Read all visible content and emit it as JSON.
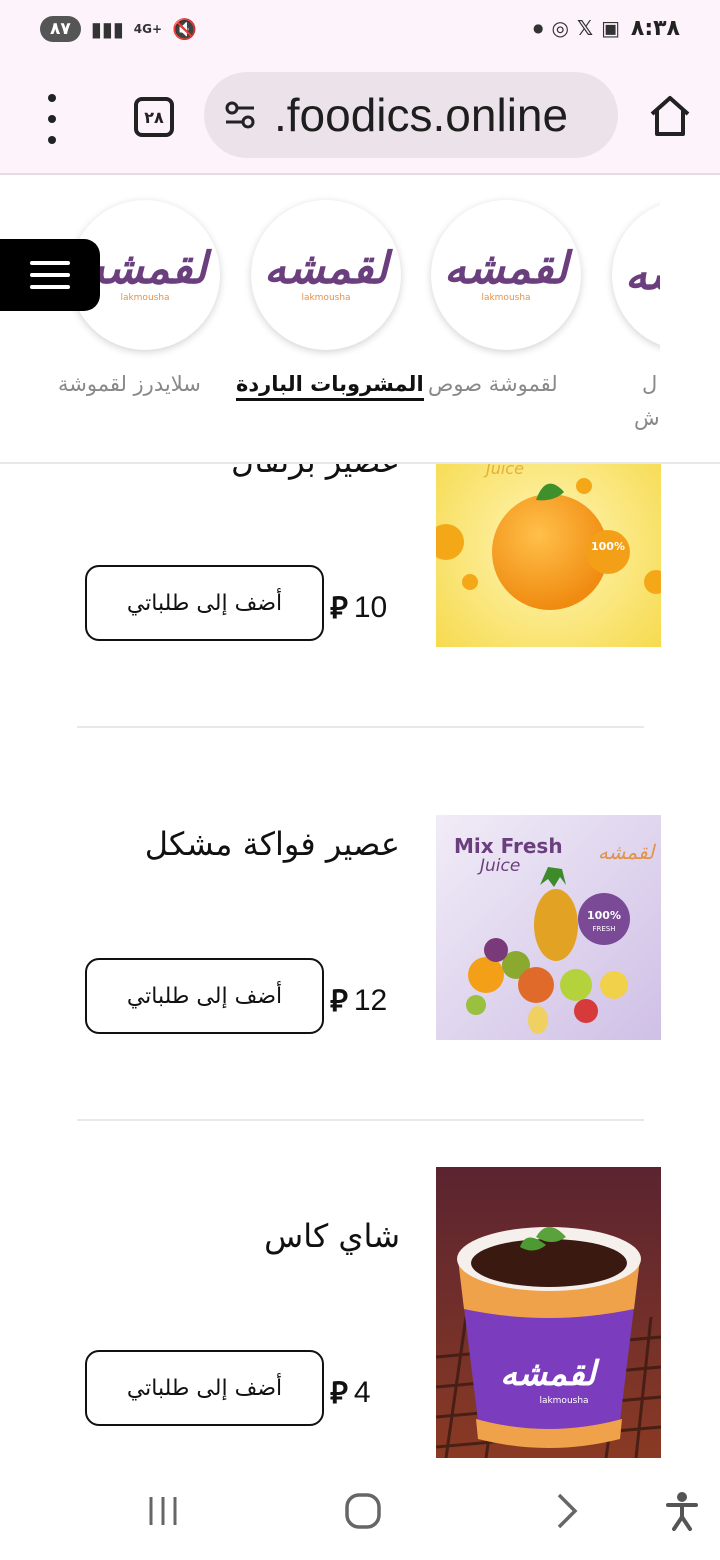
{
  "status_bar": {
    "time": "٨:٣٨",
    "battery": "٨٧",
    "network": "4G+"
  },
  "browser": {
    "url": ".foodics.online",
    "tab_count": "٢٨"
  },
  "categories": [
    {
      "label": "سلايدرز لقموشة",
      "active": false
    },
    {
      "label": "المشروبات الباردة",
      "active": true
    },
    {
      "label": "لقموشة صوص",
      "active": false
    },
    {
      "label": "ل",
      "active": false
    }
  ],
  "category_partial_second_line": "ش",
  "logo": {
    "ar": "لقمشه",
    "en": "lakmousha"
  },
  "items": [
    {
      "name": "عصير برتقال",
      "price": "10",
      "button": "أضف إلى طلباتي",
      "image_text": "Juice",
      "badge": "100%"
    },
    {
      "name": "عصير فواكة مشكل",
      "price": "12",
      "button": "أضف إلى طلباتي",
      "image_title": "Mix Fresh",
      "image_text": "Juice",
      "badge": "100%",
      "badge_sub": "FRESH"
    },
    {
      "name": "شاي كاس",
      "price": "4",
      "button": "أضف إلى طلباتي"
    }
  ],
  "colors": {
    "brand_purple": "#6b3f7e",
    "brand_orange": "#e2934b",
    "browser_bg": "#fdf3fb"
  }
}
